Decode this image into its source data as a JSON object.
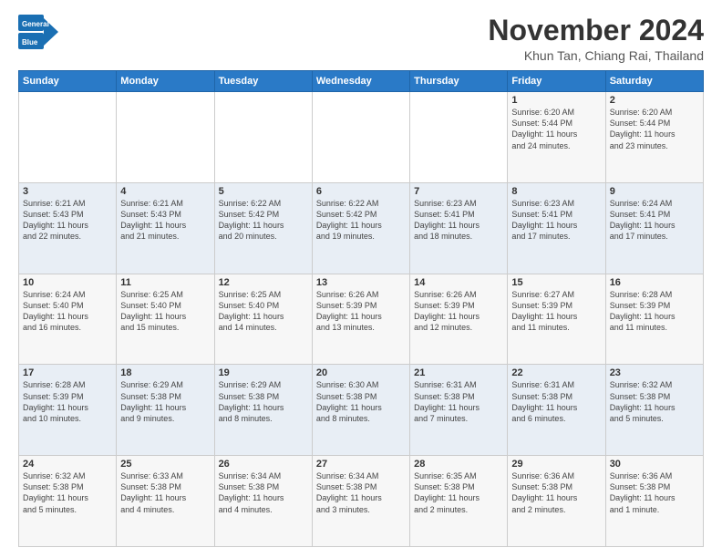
{
  "header": {
    "logo": {
      "line1": "General",
      "line2": "Blue"
    },
    "month": "November 2024",
    "location": "Khun Tan, Chiang Rai, Thailand"
  },
  "weekdays": [
    "Sunday",
    "Monday",
    "Tuesday",
    "Wednesday",
    "Thursday",
    "Friday",
    "Saturday"
  ],
  "weeks": [
    [
      {
        "day": "",
        "info": ""
      },
      {
        "day": "",
        "info": ""
      },
      {
        "day": "",
        "info": ""
      },
      {
        "day": "",
        "info": ""
      },
      {
        "day": "",
        "info": ""
      },
      {
        "day": "1",
        "info": "Sunrise: 6:20 AM\nSunset: 5:44 PM\nDaylight: 11 hours\nand 24 minutes."
      },
      {
        "day": "2",
        "info": "Sunrise: 6:20 AM\nSunset: 5:44 PM\nDaylight: 11 hours\nand 23 minutes."
      }
    ],
    [
      {
        "day": "3",
        "info": "Sunrise: 6:21 AM\nSunset: 5:43 PM\nDaylight: 11 hours\nand 22 minutes."
      },
      {
        "day": "4",
        "info": "Sunrise: 6:21 AM\nSunset: 5:43 PM\nDaylight: 11 hours\nand 21 minutes."
      },
      {
        "day": "5",
        "info": "Sunrise: 6:22 AM\nSunset: 5:42 PM\nDaylight: 11 hours\nand 20 minutes."
      },
      {
        "day": "6",
        "info": "Sunrise: 6:22 AM\nSunset: 5:42 PM\nDaylight: 11 hours\nand 19 minutes."
      },
      {
        "day": "7",
        "info": "Sunrise: 6:23 AM\nSunset: 5:41 PM\nDaylight: 11 hours\nand 18 minutes."
      },
      {
        "day": "8",
        "info": "Sunrise: 6:23 AM\nSunset: 5:41 PM\nDaylight: 11 hours\nand 17 minutes."
      },
      {
        "day": "9",
        "info": "Sunrise: 6:24 AM\nSunset: 5:41 PM\nDaylight: 11 hours\nand 17 minutes."
      }
    ],
    [
      {
        "day": "10",
        "info": "Sunrise: 6:24 AM\nSunset: 5:40 PM\nDaylight: 11 hours\nand 16 minutes."
      },
      {
        "day": "11",
        "info": "Sunrise: 6:25 AM\nSunset: 5:40 PM\nDaylight: 11 hours\nand 15 minutes."
      },
      {
        "day": "12",
        "info": "Sunrise: 6:25 AM\nSunset: 5:40 PM\nDaylight: 11 hours\nand 14 minutes."
      },
      {
        "day": "13",
        "info": "Sunrise: 6:26 AM\nSunset: 5:39 PM\nDaylight: 11 hours\nand 13 minutes."
      },
      {
        "day": "14",
        "info": "Sunrise: 6:26 AM\nSunset: 5:39 PM\nDaylight: 11 hours\nand 12 minutes."
      },
      {
        "day": "15",
        "info": "Sunrise: 6:27 AM\nSunset: 5:39 PM\nDaylight: 11 hours\nand 11 minutes."
      },
      {
        "day": "16",
        "info": "Sunrise: 6:28 AM\nSunset: 5:39 PM\nDaylight: 11 hours\nand 11 minutes."
      }
    ],
    [
      {
        "day": "17",
        "info": "Sunrise: 6:28 AM\nSunset: 5:39 PM\nDaylight: 11 hours\nand 10 minutes."
      },
      {
        "day": "18",
        "info": "Sunrise: 6:29 AM\nSunset: 5:38 PM\nDaylight: 11 hours\nand 9 minutes."
      },
      {
        "day": "19",
        "info": "Sunrise: 6:29 AM\nSunset: 5:38 PM\nDaylight: 11 hours\nand 8 minutes."
      },
      {
        "day": "20",
        "info": "Sunrise: 6:30 AM\nSunset: 5:38 PM\nDaylight: 11 hours\nand 8 minutes."
      },
      {
        "day": "21",
        "info": "Sunrise: 6:31 AM\nSunset: 5:38 PM\nDaylight: 11 hours\nand 7 minutes."
      },
      {
        "day": "22",
        "info": "Sunrise: 6:31 AM\nSunset: 5:38 PM\nDaylight: 11 hours\nand 6 minutes."
      },
      {
        "day": "23",
        "info": "Sunrise: 6:32 AM\nSunset: 5:38 PM\nDaylight: 11 hours\nand 5 minutes."
      }
    ],
    [
      {
        "day": "24",
        "info": "Sunrise: 6:32 AM\nSunset: 5:38 PM\nDaylight: 11 hours\nand 5 minutes."
      },
      {
        "day": "25",
        "info": "Sunrise: 6:33 AM\nSunset: 5:38 PM\nDaylight: 11 hours\nand 4 minutes."
      },
      {
        "day": "26",
        "info": "Sunrise: 6:34 AM\nSunset: 5:38 PM\nDaylight: 11 hours\nand 4 minutes."
      },
      {
        "day": "27",
        "info": "Sunrise: 6:34 AM\nSunset: 5:38 PM\nDaylight: 11 hours\nand 3 minutes."
      },
      {
        "day": "28",
        "info": "Sunrise: 6:35 AM\nSunset: 5:38 PM\nDaylight: 11 hours\nand 2 minutes."
      },
      {
        "day": "29",
        "info": "Sunrise: 6:36 AM\nSunset: 5:38 PM\nDaylight: 11 hours\nand 2 minutes."
      },
      {
        "day": "30",
        "info": "Sunrise: 6:36 AM\nSunset: 5:38 PM\nDaylight: 11 hours\nand 1 minute."
      }
    ]
  ]
}
